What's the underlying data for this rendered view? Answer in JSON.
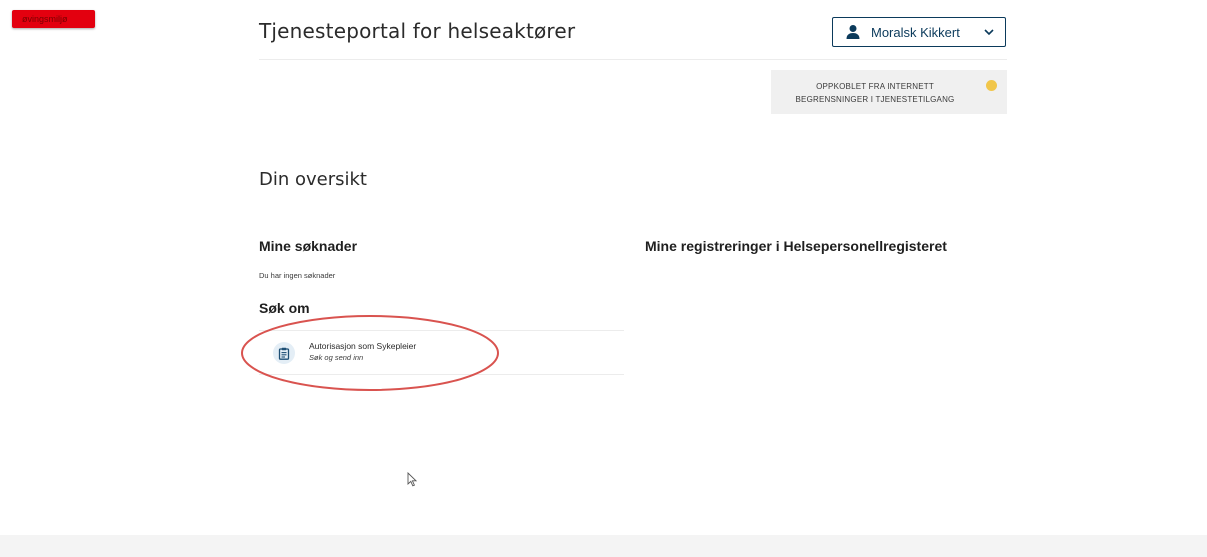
{
  "environment_badge": "øvingsmiljø",
  "header": {
    "title": "Tjenesteportal for helseaktører",
    "user": {
      "name": "Moralsk Kikkert",
      "icon": "user-icon",
      "dropdown_icon": "chevron-down-icon"
    }
  },
  "status": {
    "line1": "OPPKOBLET FRA INTERNETT",
    "line2": "BEGRENSNINGER I TJENESTETILGANG",
    "indicator_color": "#f1c64a"
  },
  "main": {
    "title": "Din oversikt",
    "applications": {
      "heading": "Mine søknader",
      "empty_text": "Du har ingen søknader"
    },
    "apply": {
      "heading": "Søk om",
      "items": [
        {
          "title": "Autorisasjon som Sykepleier",
          "subtitle": "Søk og send inn",
          "icon": "clipboard-icon"
        }
      ]
    },
    "registrations": {
      "heading": "Mine registreringer i Helsepersonellregisteret"
    }
  },
  "colors": {
    "accent": "#0b3a5b",
    "badge": "#e3000f",
    "highlight": "#d9534f"
  }
}
